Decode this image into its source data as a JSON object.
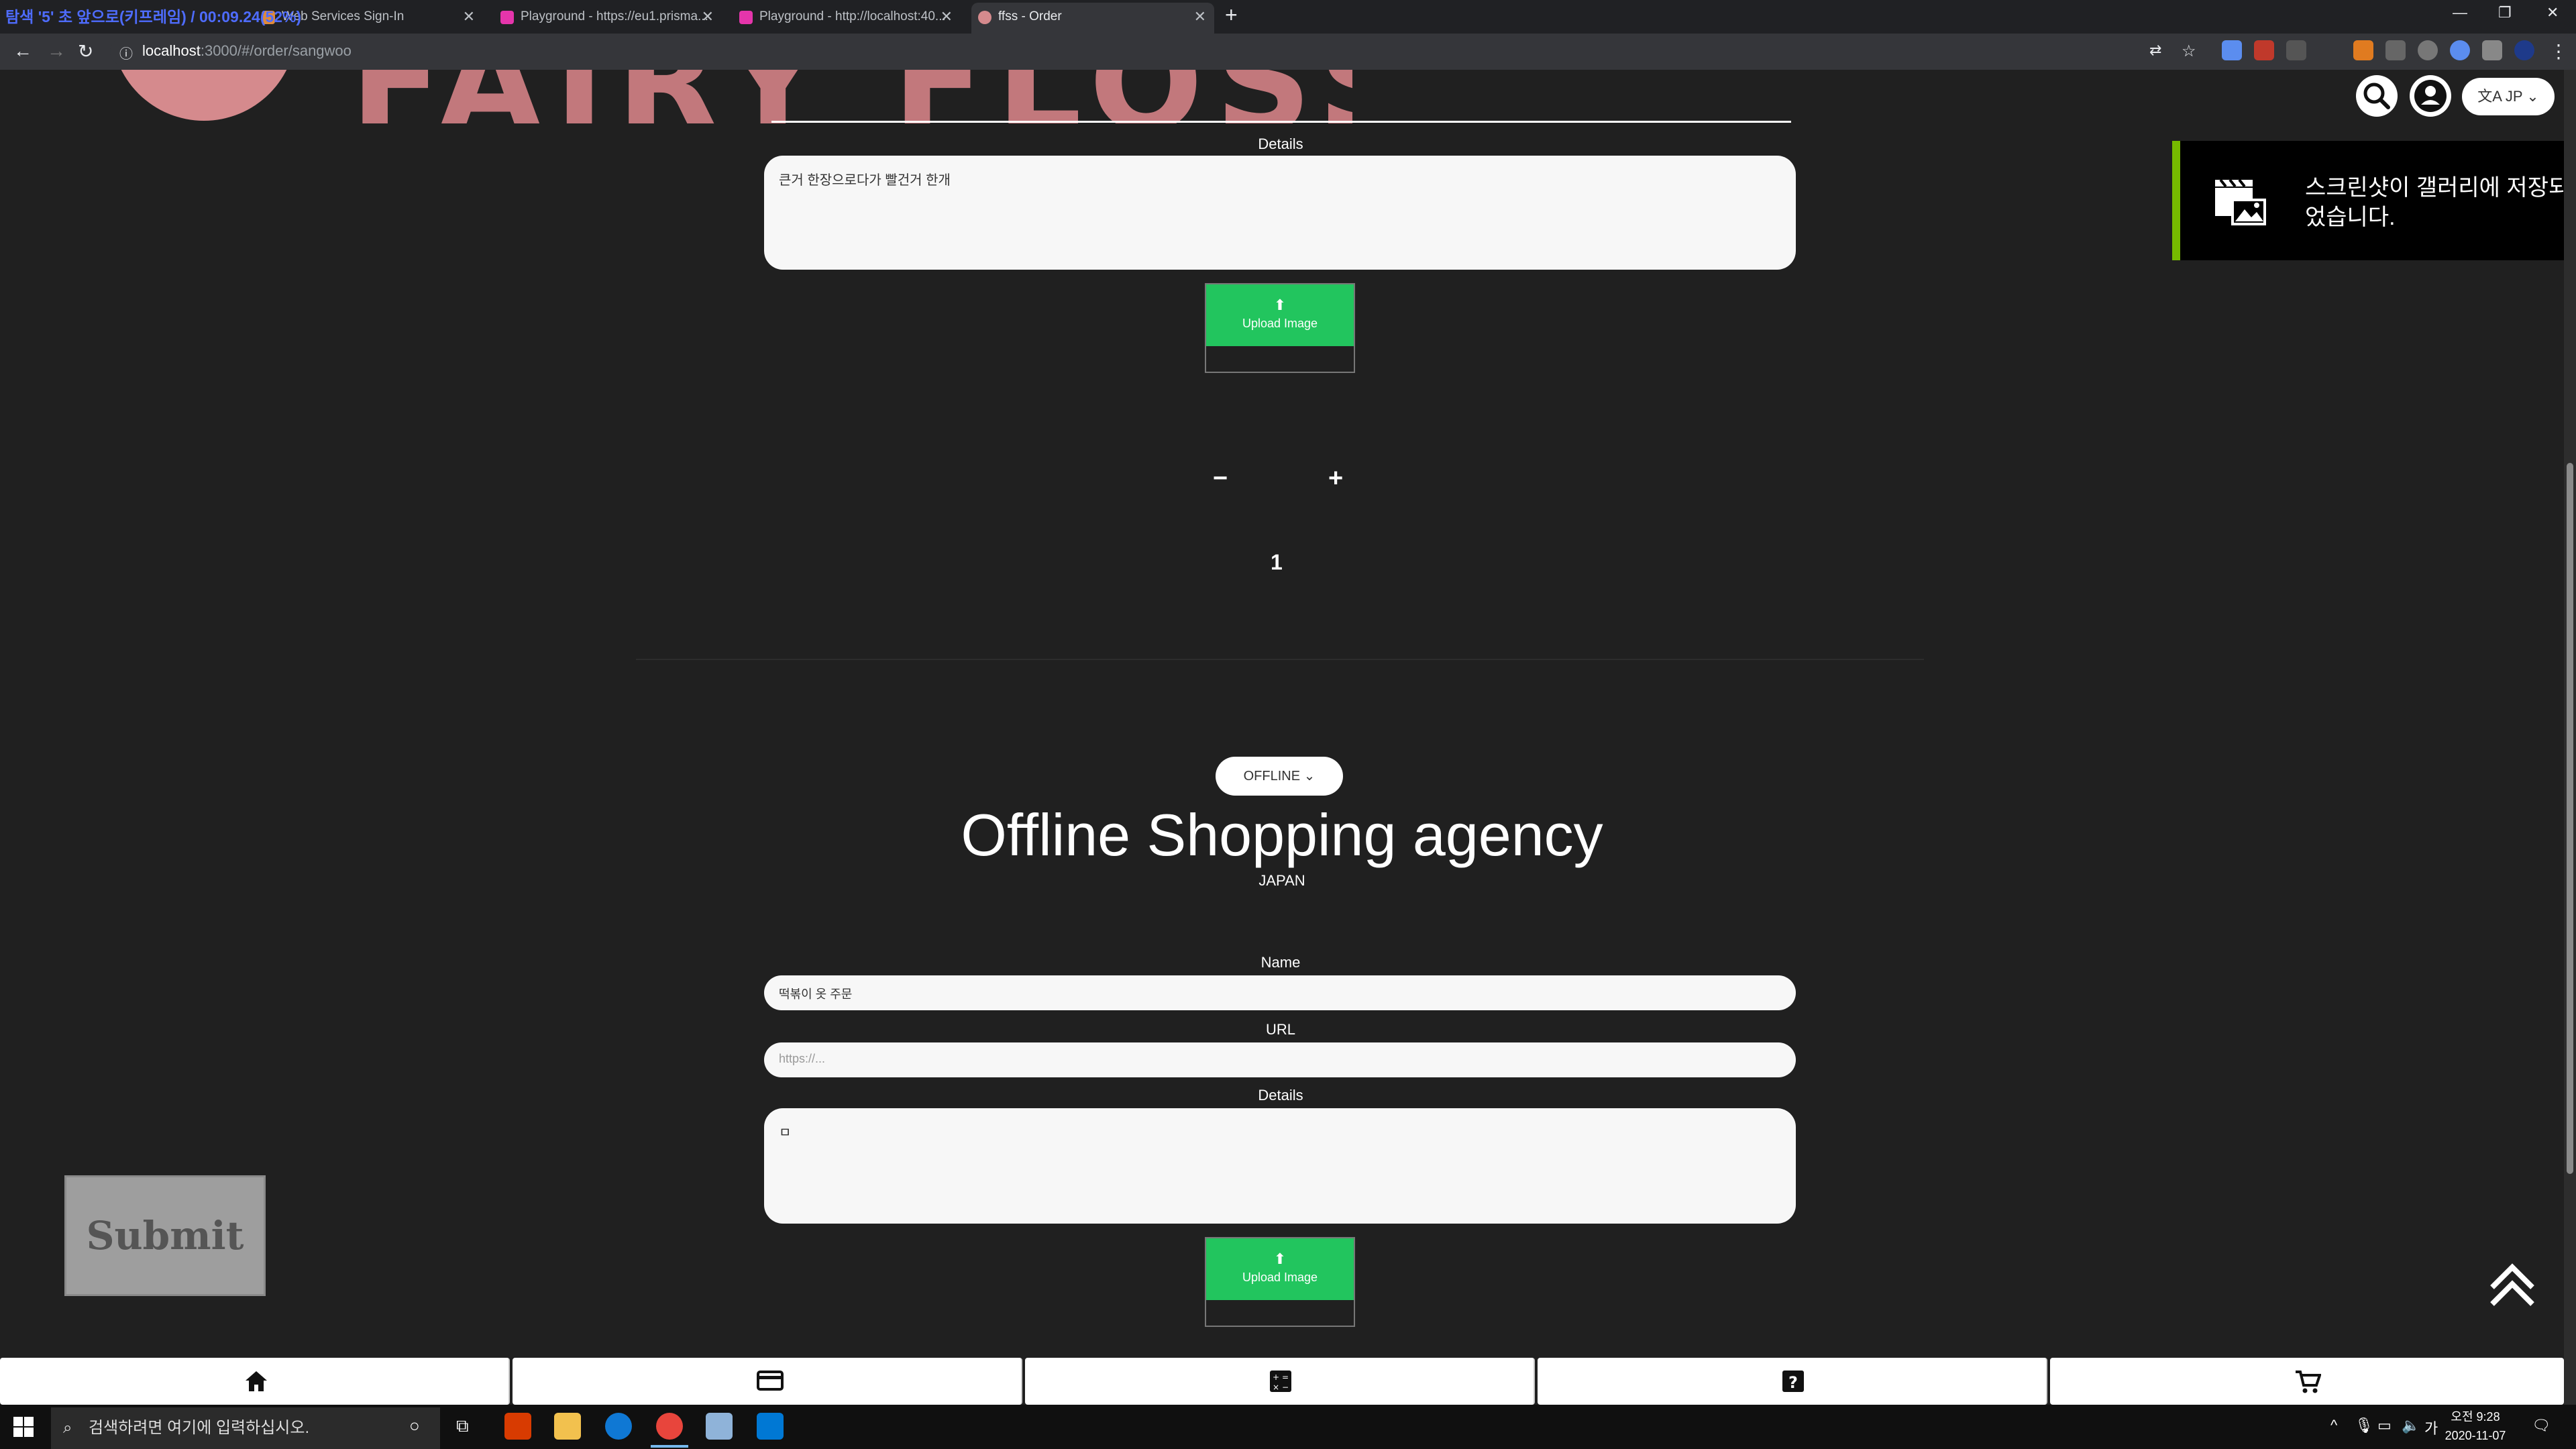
{
  "recording_overlay": "탐색 '5' 초 앞으로(키프레임) / 00:09.24(52%)",
  "tabs": [
    {
      "title": "Web Services Sign-In"
    },
    {
      "title": "Playground - https://eu1.prisma..."
    },
    {
      "title": "Playground - http://localhost:40..."
    },
    {
      "title": "ffss - Order"
    }
  ],
  "address": {
    "host": "localhost",
    "path": ":3000/#/order/sangwoo"
  },
  "header": {
    "lang_label": "JP"
  },
  "order_item_1": {
    "details_label": "Details",
    "details_value": "큰거 한장으로다가 빨건거 한개",
    "upload_label": "Upload Image",
    "qty_minus": "−",
    "qty_plus": "+",
    "quantity": "1"
  },
  "service": {
    "type_button": "OFFLINE",
    "title": "Offline Shopping agency",
    "country": "JAPAN"
  },
  "order_item_2": {
    "name_label": "Name",
    "name_value": "떡볶이 옷 주문",
    "url_label": "URL",
    "url_placeholder": "https://...",
    "details_label": "Details",
    "details_value": "ㅁ",
    "upload_label": "Upload Image"
  },
  "submit_label": "Submit",
  "toast": {
    "message": "스크린샷이 갤러리에 저장되었습니다."
  },
  "taskbar": {
    "search_placeholder": "검색하려면 여기에 입력하십시오.",
    "time": "오전 9:28",
    "date": "2020-11-07",
    "ime": "가"
  },
  "colors": {
    "accent_green": "#22c55e",
    "page_bg": "#202020",
    "toast_border": "#76b900",
    "logo_pink": "#c2787c"
  }
}
